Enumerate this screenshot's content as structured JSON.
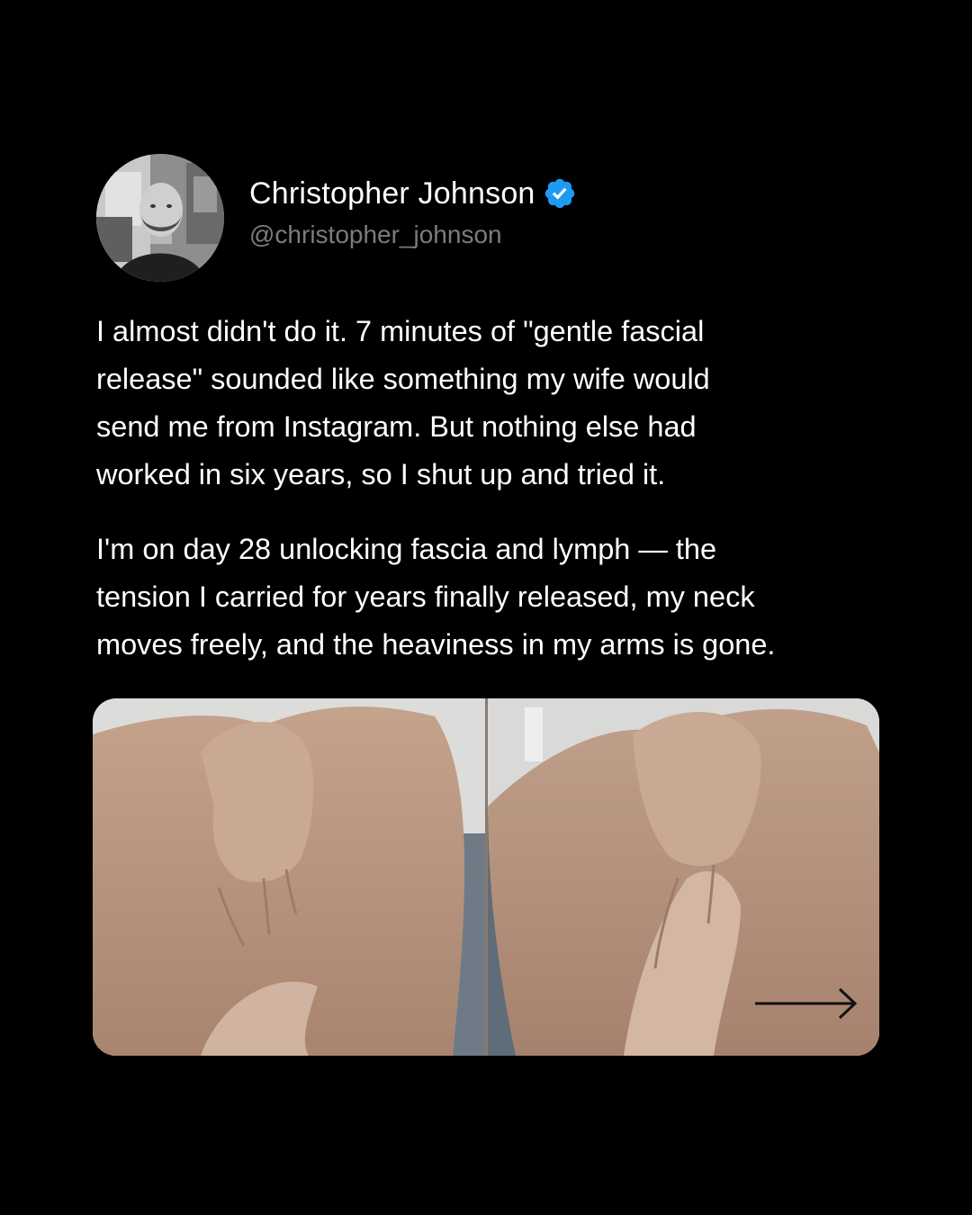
{
  "author": {
    "name": "Christopher Johnson",
    "handle": "@christopher_johnson",
    "verified": true,
    "verified_color": "#1D9BF0",
    "avatar_icon": "avatar-photo"
  },
  "post": {
    "paragraphs": [
      "I almost didn't do it. 7 minutes of \"gentle fascial\nrelease\" sounded like something my wife would\nsend me from Instagram. But nothing else had\nworked in six years, so I shut up and tried it.",
      "I'm on day 28 unlocking fascia and lymph — the\ntension I carried for years finally released, my neck\nmoves freely, and the heaviness in my arms is gone."
    ]
  },
  "media": {
    "panels": 2,
    "next_icon": "arrow-right-icon"
  },
  "colors": {
    "background": "#000000",
    "text": "#FFFFFF",
    "handle_text": "#7C7C7C",
    "skin": "#B99A86"
  }
}
